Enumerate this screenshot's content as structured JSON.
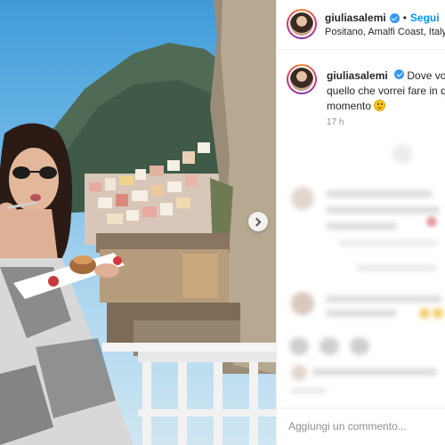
{
  "post": {
    "username": "giuliasalemi",
    "separator": "•",
    "follow_label": "Segui",
    "location": "Positano, Amalfi Coast, Italy"
  },
  "caption": {
    "username": "giuliasalemi",
    "line1": "Dove vorrei",
    "line2": "quello che vorrei fare in q",
    "line3": "momento",
    "time": "17 h"
  },
  "comment_input": {
    "placeholder": "Aggiungi un commento..."
  },
  "icons": {
    "verified": "verified-badge-icon",
    "next": "chevron-right-icon",
    "emoji": "smiling-face-emoji"
  },
  "colors": {
    "accent": "#0095f6",
    "verified": "#3897f0",
    "muted": "#8e8e8e"
  }
}
